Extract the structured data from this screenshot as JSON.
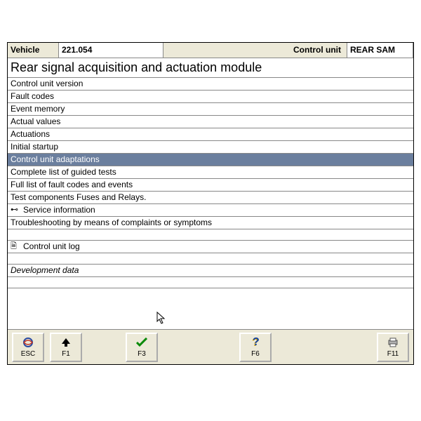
{
  "header": {
    "vehicle_label": "Vehicle",
    "vehicle_value": "221.054",
    "control_unit_label": "Control unit",
    "control_unit_value": "REAR SAM"
  },
  "title": "Rear signal acquisition and actuation module",
  "menu": {
    "items": [
      {
        "label": "Control unit version",
        "selected": false
      },
      {
        "label": "Fault codes",
        "selected": false
      },
      {
        "label": "Event memory",
        "selected": false
      },
      {
        "label": "Actual values",
        "selected": false
      },
      {
        "label": "Actuations",
        "selected": false
      },
      {
        "label": "Initial startup",
        "selected": false
      },
      {
        "label": "Control unit adaptations",
        "selected": true
      },
      {
        "label": "Complete list of guided tests",
        "selected": false
      },
      {
        "label": "Full list of fault codes and events",
        "selected": false
      },
      {
        "label": "Test components Fuses and Relays.",
        "selected": false
      }
    ],
    "service_info": "Service information",
    "troubleshooting": "Troubleshooting by means of complaints or symptoms",
    "control_unit_log": "Control unit log",
    "development_data": "Development data"
  },
  "fkeys": {
    "esc": "ESC",
    "f1": "F1",
    "f3": "F3",
    "f6": "F6",
    "f11": "F11"
  },
  "colors": {
    "selection": "#6b7f9e",
    "panel": "#ece9d8"
  }
}
